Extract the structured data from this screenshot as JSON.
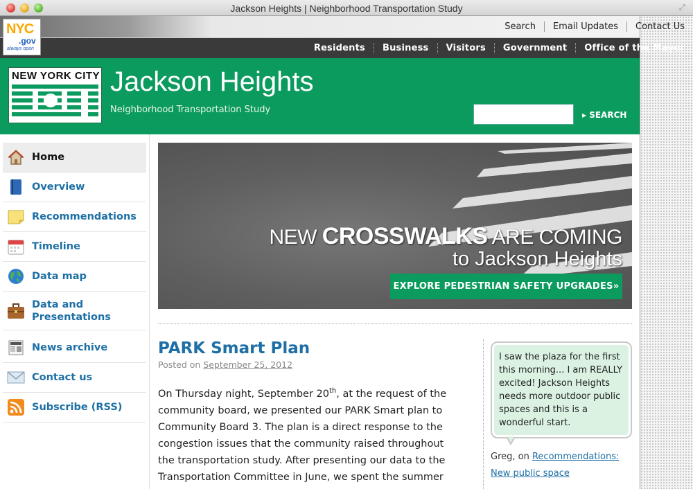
{
  "window": {
    "title": "Jackson Heights | Neighborhood Transportation Study"
  },
  "nyc_logo": {
    "text": "NYC",
    "suffix": ".gov",
    "tagline": "always open"
  },
  "utility_links": [
    "Search",
    "Email Updates",
    "Contact Us"
  ],
  "main_nav": [
    "Residents",
    "Business",
    "Visitors",
    "Government",
    "Office of the Mayor"
  ],
  "dot_logo": {
    "text": "NEW YORK CITY"
  },
  "header": {
    "title": "Jackson Heights",
    "subtitle": "Neighborhood Transportation Study",
    "search_placeholder": "",
    "search_button": "SEARCH"
  },
  "sidebar": {
    "items": [
      {
        "label": "Home",
        "icon": "home-icon"
      },
      {
        "label": "Overview",
        "icon": "book-icon"
      },
      {
        "label": "Recommendations",
        "icon": "note-icon"
      },
      {
        "label": "Timeline",
        "icon": "calendar-icon"
      },
      {
        "label": "Data map",
        "icon": "globe-icon"
      },
      {
        "label": "Data and Presentations",
        "icon": "briefcase-icon"
      },
      {
        "label": "News archive",
        "icon": "newspaper-icon"
      },
      {
        "label": "Contact us",
        "icon": "envelope-icon"
      },
      {
        "label": "Subscribe (RSS)",
        "icon": "rss-icon"
      }
    ]
  },
  "hero": {
    "line1_a": "NEW ",
    "line1_b": "CROSSWALKS",
    "line1_c": " ARE COMING",
    "line2": "to Jackson Heights",
    "button": "EXPLORE PEDESTRIAN SAFETY UPGRADES»"
  },
  "post": {
    "title": "PARK Smart Plan",
    "posted_on": "Posted on ",
    "date": "September 25, 2012",
    "body_p1": "On Thursday night, September 20",
    "body_sup": "th",
    "body_p2": ", at the request of the community board, we presented our PARK Smart plan to Community Board 3. The plan is a direct response to the congestion issues that the community raised throughout the transportation study. After presenting our data to the Transportation Committee in June, we spent the summer"
  },
  "testimonial": {
    "quote": "I saw the plaza for the first this morning... I am REALLY excited! Jackson Heights needs more outdoor public spaces and this is a wonderful start.",
    "author": "Greg, on ",
    "link": "Recommendations: New public space"
  },
  "colors": {
    "green": "#0c9b5e",
    "link_blue": "#1d6fa5",
    "nav_dark": "#3a3a3a"
  }
}
